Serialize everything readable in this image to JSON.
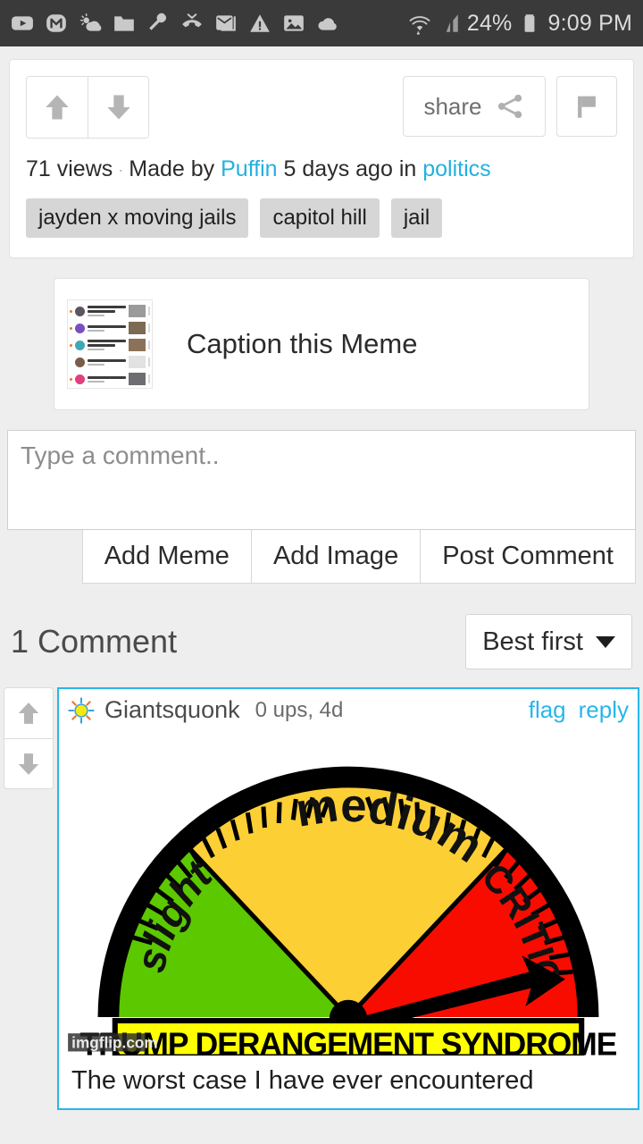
{
  "statusbar": {
    "icons": [
      "youtube-icon",
      "monzo-m-icon",
      "weather-icon",
      "folder-icon",
      "wrench-icon",
      "missed-call-icon",
      "mail-icon",
      "warning-icon",
      "image-icon",
      "cloud-icon"
    ],
    "wifi_icon": "wifi-icon",
    "signal_icon": "cell-signal-icon",
    "battery_percent": "24%",
    "battery_icon": "battery-icon",
    "time": "9:09 PM"
  },
  "meta": {
    "upvote_icon": "arrow-up-icon",
    "downvote_icon": "arrow-down-icon",
    "share_label": "share",
    "share_icon": "share-icon",
    "flag_icon": "flag-icon",
    "views": "71 views",
    "separator": "·",
    "made_by_label": "Made by",
    "author": "Puffin",
    "age": "5 days ago",
    "in_label": "in",
    "stream": "politics",
    "tags": [
      "jayden x moving jails",
      "capitol hill",
      "jail"
    ]
  },
  "caption": {
    "thumbnail_icon": "meme-thumbnail",
    "label": "Caption this Meme",
    "thumb_rows": [
      {
        "avatar_color": "#5c5560",
        "has_dot": true,
        "image_color": "#9a9a9a"
      },
      {
        "avatar_color": "#7a4fc0",
        "has_dot": true,
        "image_color": "#7d6a55"
      },
      {
        "avatar_color": "#3fa9b5",
        "has_dot": true,
        "image_color": "#8a7259"
      },
      {
        "avatar_color": "#7a5c4a",
        "has_dot": false,
        "image_color": "#e2e2e2"
      },
      {
        "avatar_color": "#e0407c",
        "has_dot": true,
        "image_color": "#6e6e72"
      }
    ]
  },
  "composer": {
    "placeholder": "Type a comment..",
    "value": "",
    "buttons": [
      "Add Meme",
      "Add Image",
      "Post Comment"
    ]
  },
  "comments_header": {
    "count_label": "1 Comment",
    "sort_label": "Best first",
    "sort_caret_icon": "chevron-down-icon"
  },
  "comment": {
    "upvote_icon": "arrow-up-icon",
    "downvote_icon": "arrow-down-icon",
    "avatar_icon": "sun-avatar-icon",
    "username": "Giantsquonk",
    "meta": "0 ups, 4d",
    "flag_label": "flag",
    "reply_label": "reply",
    "text": "The worst case I have ever encountered",
    "border_color": "#29b6e8",
    "meme": {
      "alt": "gauge-meme",
      "banner_text": "TRUMP DERANGEMENT SYNDROME",
      "watermark": "imgflip.com",
      "labels": {
        "left": "slight",
        "middle": "medium",
        "right": "CRITICAL"
      },
      "colors": {
        "green": "#5cc800",
        "yellow": "#fccf35",
        "red": "#f90c00",
        "banner": "#ffff00",
        "outline": "#000000"
      },
      "needle_target": "CRITICAL"
    }
  }
}
